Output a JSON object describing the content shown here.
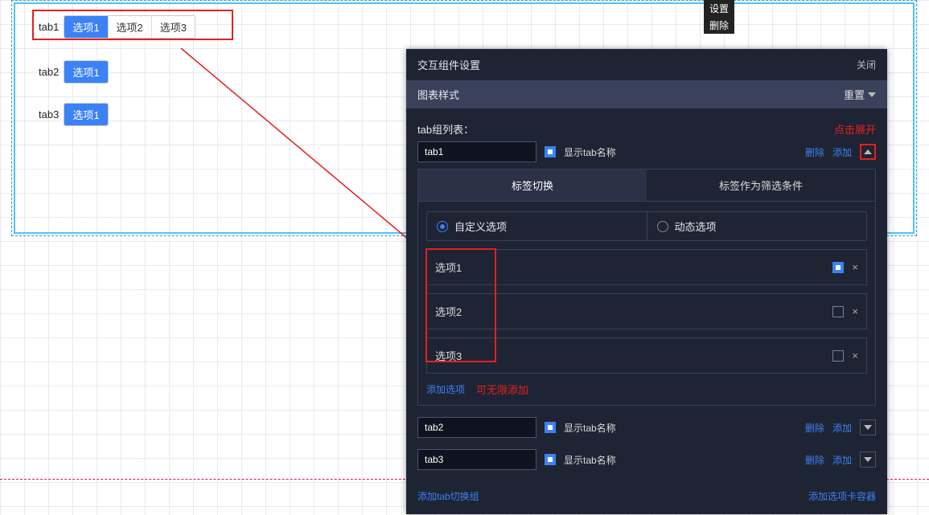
{
  "floating_menu": {
    "settings": "设置",
    "delete": "删除"
  },
  "preview": {
    "tab1": {
      "label": "tab1",
      "options": [
        "选项1",
        "选项2",
        "选项3"
      ],
      "active": 0
    },
    "tab2": {
      "label": "tab2",
      "options": [
        "选项1"
      ],
      "active": 0
    },
    "tab3": {
      "label": "tab3",
      "options": [
        "选项1"
      ],
      "active": 0
    }
  },
  "panel": {
    "title": "交互组件设置",
    "close": "关闭",
    "style_label": "图表样式",
    "reset": "重置",
    "list_label": "tab组列表：",
    "hint_expand": "点击展开",
    "show_tab_name": "显示tab名称",
    "actions": {
      "delete": "删除",
      "add": "添加"
    },
    "seg": {
      "switch": "标签切换",
      "filter": "标签作为筛选条件"
    },
    "radio": {
      "custom": "自定义选项",
      "dynamic": "动态选项"
    },
    "add_option": "添加选项",
    "hint_unlimited": "可无限添加",
    "footer": {
      "add_group": "添加tab切换组",
      "add_container": "添加选项卡容器"
    },
    "groups": [
      {
        "name": "tab1",
        "expanded": true,
        "options": [
          {
            "label": "选项1",
            "default": true
          },
          {
            "label": "选项2",
            "default": false
          },
          {
            "label": "选项3",
            "default": false
          }
        ]
      },
      {
        "name": "tab2",
        "expanded": false
      },
      {
        "name": "tab3",
        "expanded": false
      }
    ]
  }
}
